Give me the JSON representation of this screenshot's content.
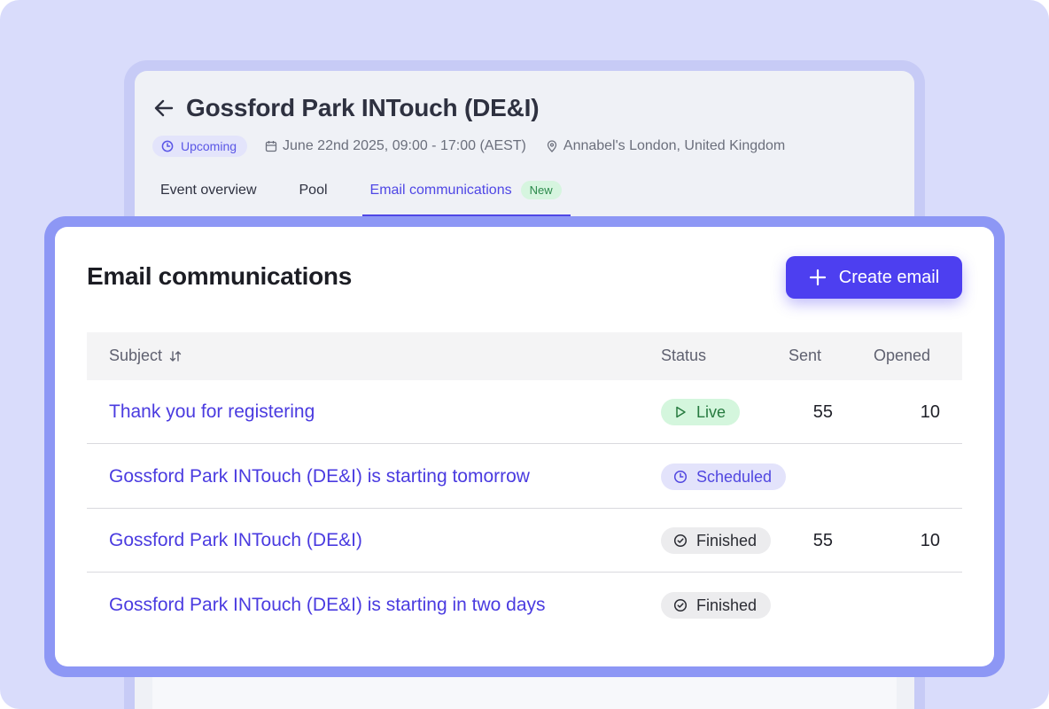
{
  "event": {
    "title": "Gossford Park INTouch (DE&I)",
    "status_chip": "Upcoming",
    "date": "June 22nd 2025, 09:00 - 17:00 (AEST)",
    "location": "Annabel's London, United Kingdom"
  },
  "tabs": [
    {
      "label": "Event overview"
    },
    {
      "label": "Pool"
    },
    {
      "label": "Email communications",
      "badge": "New",
      "active": true
    }
  ],
  "panel": {
    "title": "Email communications",
    "create_button": "Create email"
  },
  "table": {
    "headers": {
      "subject": "Subject",
      "status": "Status",
      "sent": "Sent",
      "opened": "Opened"
    },
    "rows": [
      {
        "subject": "Thank you for registering",
        "status": "Live",
        "sent": "55",
        "opened": "10"
      },
      {
        "subject": "Gossford Park INTouch (DE&I) is starting tomorrow",
        "status": "Scheduled",
        "sent": "",
        "opened": ""
      },
      {
        "subject": "Gossford Park INTouch (DE&I)",
        "status": "Finished",
        "sent": "55",
        "opened": "10"
      },
      {
        "subject": "Gossford Park INTouch (DE&I) is starting in two days",
        "status": "Finished",
        "sent": "",
        "opened": ""
      }
    ]
  },
  "colors": {
    "accent": "#4d3ff0",
    "live": "#267a3f",
    "scheduled": "#5147e0",
    "finished": "#2b2c33"
  }
}
